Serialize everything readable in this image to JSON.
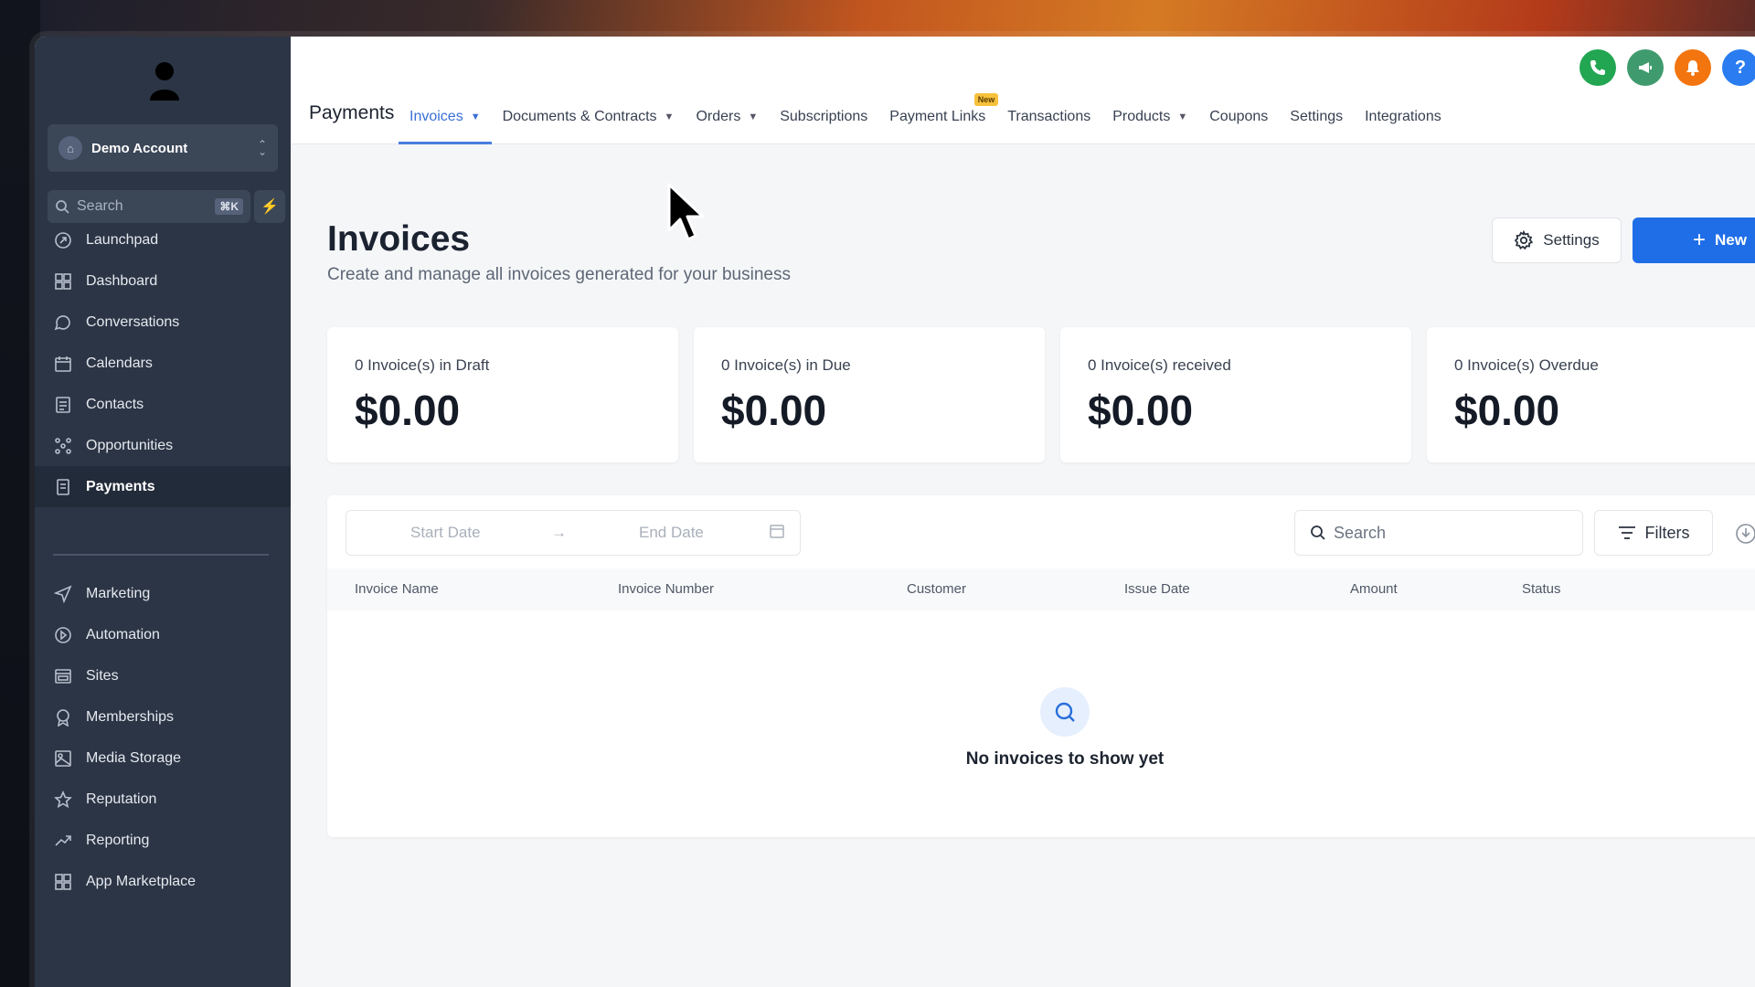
{
  "sidebar": {
    "account_name": "Demo Account",
    "search_placeholder": "Search",
    "shortcut": "⌘K",
    "items": [
      {
        "label": "Launchpad",
        "icon": "rocket-icon"
      },
      {
        "label": "Dashboard",
        "icon": "grid-icon"
      },
      {
        "label": "Conversations",
        "icon": "chat-icon"
      },
      {
        "label": "Calendars",
        "icon": "calendar-icon"
      },
      {
        "label": "Contacts",
        "icon": "contacts-icon"
      },
      {
        "label": "Opportunities",
        "icon": "pipeline-icon"
      },
      {
        "label": "Payments",
        "icon": "receipt-icon"
      }
    ],
    "items2": [
      {
        "label": "Marketing",
        "icon": "send-icon"
      },
      {
        "label": "Automation",
        "icon": "automation-icon"
      },
      {
        "label": "Sites",
        "icon": "sites-icon"
      },
      {
        "label": "Memberships",
        "icon": "award-icon"
      },
      {
        "label": "Media Storage",
        "icon": "image-icon"
      },
      {
        "label": "Reputation",
        "icon": "star-icon"
      },
      {
        "label": "Reporting",
        "icon": "trend-icon"
      },
      {
        "label": "App Marketplace",
        "icon": "apps-icon"
      }
    ]
  },
  "topbar": {
    "app_title": "Payments",
    "tabs": [
      {
        "label": "Invoices"
      },
      {
        "label": "Documents & Contracts"
      },
      {
        "label": "Orders"
      },
      {
        "label": "Subscriptions"
      },
      {
        "label": "Payment Links",
        "badge": "New"
      },
      {
        "label": "Transactions"
      },
      {
        "label": "Products"
      },
      {
        "label": "Coupons"
      },
      {
        "label": "Settings"
      },
      {
        "label": "Integrations"
      }
    ],
    "help_label": "?"
  },
  "page": {
    "title": "Invoices",
    "subtitle": "Create and manage all invoices generated for your business",
    "settings_button": "Settings",
    "new_button": "New"
  },
  "stats": [
    {
      "label": "0 Invoice(s) in Draft",
      "value": "$0.00"
    },
    {
      "label": "0 Invoice(s) in Due",
      "value": "$0.00"
    },
    {
      "label": "0 Invoice(s) received",
      "value": "$0.00"
    },
    {
      "label": "0 Invoice(s) Overdue",
      "value": "$0.00"
    }
  ],
  "table": {
    "start_date_placeholder": "Start Date",
    "end_date_placeholder": "End Date",
    "search_placeholder": "Search",
    "filters_label": "Filters",
    "columns": [
      "Invoice Name",
      "Invoice Number",
      "Customer",
      "Issue Date",
      "Amount",
      "Status"
    ],
    "empty_text": "No invoices to show yet"
  },
  "colors": {
    "accent": "#1f6ee8",
    "sidebar_bg": "#2b3545"
  }
}
